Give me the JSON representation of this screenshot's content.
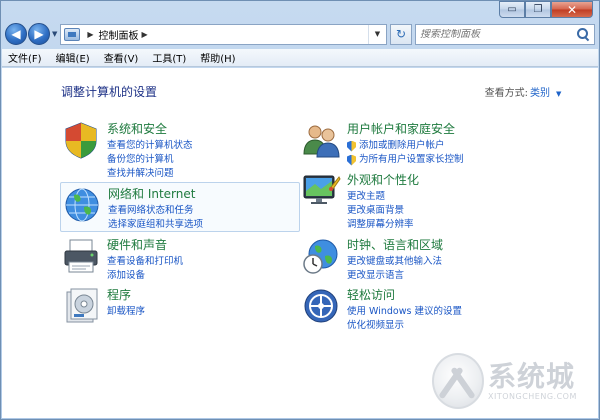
{
  "window": {
    "controls": {
      "minimize": "▭",
      "maximize": "❐",
      "close": "✕"
    }
  },
  "nav": {
    "back": "◀",
    "forward": "▶",
    "address_path": "控制面板",
    "search_placeholder": "搜索控制面板",
    "refresh": "↻"
  },
  "menu": {
    "items": [
      "文件(F)",
      "编辑(E)",
      "查看(V)",
      "工具(T)",
      "帮助(H)"
    ]
  },
  "page": {
    "title": "调整计算机的设置",
    "view_by_label": "查看方式:",
    "view_by_value": "类别"
  },
  "categories": [
    {
      "title": "系统和安全",
      "links": [
        "查看您的计算机状态",
        "备份您的计算机",
        "查找并解决问题"
      ]
    },
    {
      "title": "网络和 Internet",
      "links": [
        "查看网络状态和任务",
        "选择家庭组和共享选项"
      ]
    },
    {
      "title": "硬件和声音",
      "links": [
        "查看设备和打印机",
        "添加设备"
      ]
    },
    {
      "title": "程序",
      "links": [
        "卸载程序"
      ]
    },
    {
      "title": "用户帐户和家庭安全",
      "links": [
        "添加或删除用户帐户",
        "为所有用户设置家长控制"
      ]
    },
    {
      "title": "外观和个性化",
      "links": [
        "更改主题",
        "更改桌面背景",
        "调整屏幕分辨率"
      ]
    },
    {
      "title": "时钟、语言和区域",
      "links": [
        "更改键盘或其他输入法",
        "更改显示语言"
      ]
    },
    {
      "title": "轻松访问",
      "links": [
        "使用 Windows 建议的设置",
        "优化视频显示"
      ]
    }
  ],
  "watermark": {
    "main": "系统城",
    "sub": "XITONGCHENG.COM"
  }
}
